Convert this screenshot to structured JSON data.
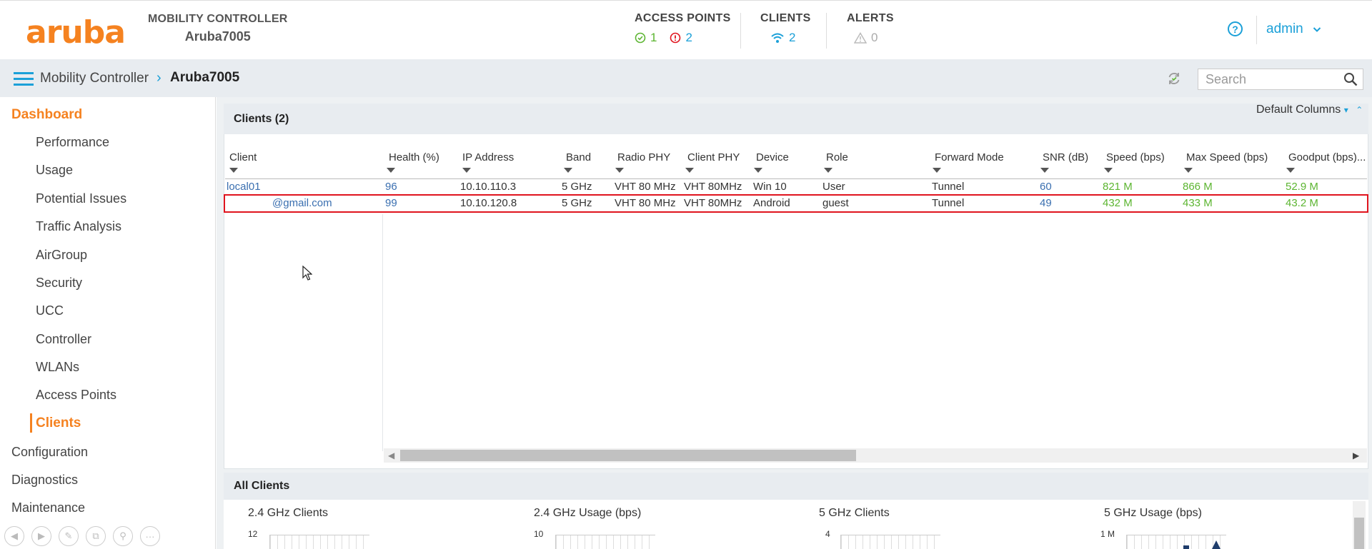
{
  "header": {
    "logo": "aruba",
    "controller_label": "MOBILITY CONTROLLER",
    "controller_name": "Aruba7005",
    "access_points": {
      "title": "ACCESS POINTS",
      "up": "1",
      "down": "2"
    },
    "clients": {
      "title": "CLIENTS",
      "count": "2"
    },
    "alerts": {
      "title": "ALERTS",
      "count": "0"
    },
    "help": "?",
    "user": "admin"
  },
  "breadcrumb": {
    "parent": "Mobility Controller",
    "separator": "›",
    "current": "Aruba7005",
    "search_placeholder": "Search"
  },
  "sidebar": {
    "dashboard": "Dashboard",
    "items": [
      "Performance",
      "Usage",
      "Potential Issues",
      "Traffic Analysis",
      "AirGroup",
      "Security",
      "UCC",
      "Controller",
      "WLANs",
      "Access Points",
      "Clients"
    ],
    "configuration": "Configuration",
    "diagnostics": "Diagnostics",
    "maintenance": "Maintenance"
  },
  "clients_panel": {
    "title": "Clients (2)",
    "default_columns": "Default Columns",
    "columns": [
      "Client",
      "Health (%)",
      "IP Address",
      "Band",
      "Radio PHY",
      "Client PHY",
      "Device",
      "Role",
      "Forward Mode",
      "SNR (dB)",
      "Speed (bps)",
      "Max Speed (bps)",
      "Goodput (bps)..."
    ],
    "rows": [
      [
        "local01",
        "96",
        "10.10.110.3",
        "5 GHz",
        "VHT 80 MHz",
        "VHT 80MHz",
        "Win 10",
        "User",
        "Tunnel",
        "60",
        "821 M",
        "866 M",
        "52.9 M"
      ],
      [
        "@gmail.com",
        "99",
        "10.10.120.8",
        "5 GHz",
        "VHT 80 MHz",
        "VHT 80MHz",
        "Android",
        "guest",
        "Tunnel",
        "49",
        "432 M",
        "433 M",
        "43.2 M"
      ]
    ]
  },
  "all_clients_panel": {
    "title": "All Clients",
    "charts": [
      {
        "title": "2.4 GHz Clients",
        "ymax": "12"
      },
      {
        "title": "2.4 GHz Usage (bps)",
        "ymax": "10"
      },
      {
        "title": "5 GHz Clients",
        "ymax": "4"
      },
      {
        "title": "5 GHz Usage (bps)",
        "ymax": "1 M"
      }
    ]
  },
  "colors": {
    "accent": "#f58220",
    "link": "#1ba0d8",
    "highlight": "#e0141e",
    "good": "#5cb531"
  }
}
